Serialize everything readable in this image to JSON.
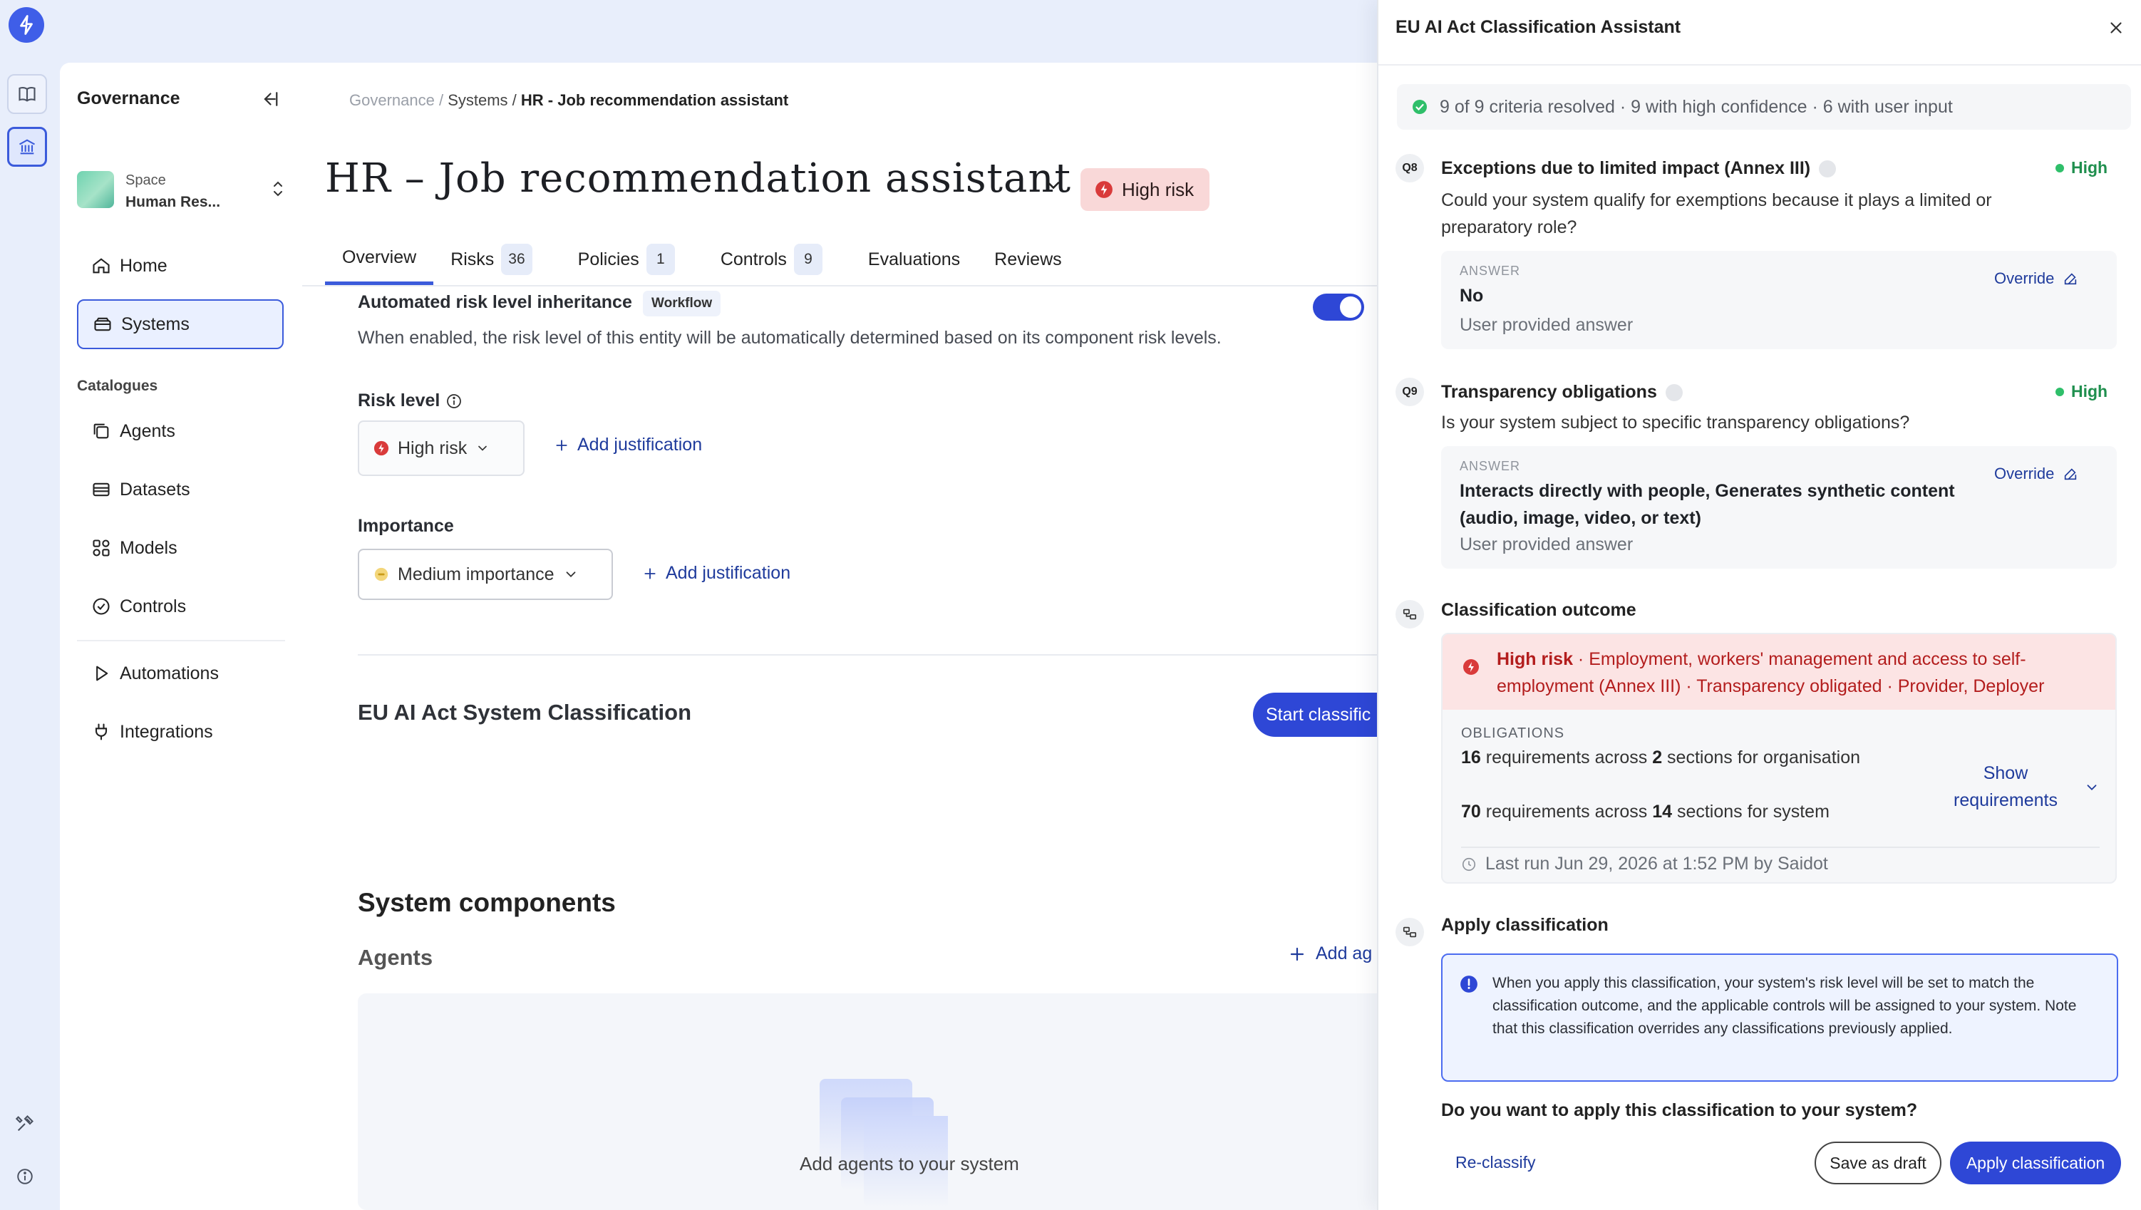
{
  "rail": {
    "logo_icon": "bolt-icon",
    "items": [
      "book-icon",
      "bank-icon"
    ],
    "bottom": [
      "tools-icon",
      "info-icon"
    ]
  },
  "nav": {
    "title": "Governance",
    "space": {
      "label": "Space",
      "name": "Human Res..."
    },
    "items": [
      {
        "label": "Home",
        "icon": "home-icon"
      },
      {
        "label": "Systems",
        "icon": "systems-icon"
      }
    ],
    "catalogues_label": "Catalogues",
    "catalogues": [
      {
        "label": "Agents",
        "icon": "agents-icon"
      },
      {
        "label": "Datasets",
        "icon": "datasets-icon"
      },
      {
        "label": "Models",
        "icon": "models-icon"
      },
      {
        "label": "Controls",
        "icon": "controls-icon"
      }
    ],
    "extras": [
      {
        "label": "Automations",
        "icon": "play-icon"
      },
      {
        "label": "Integrations",
        "icon": "plug-icon"
      }
    ]
  },
  "breadcrumb": {
    "root": "Governance",
    "sep": " / ",
    "parent": "Systems",
    "current": "HR - Job recommendation assistant"
  },
  "page": {
    "title": "HR – Job recommendation assistant",
    "risk_badge": "High risk",
    "tabs": [
      {
        "label": "Overview",
        "count": ""
      },
      {
        "label": "Risks",
        "count": "36"
      },
      {
        "label": "Policies",
        "count": "1"
      },
      {
        "label": "Controls",
        "count": "9"
      },
      {
        "label": "Evaluations",
        "count": ""
      },
      {
        "label": "Reviews",
        "count": ""
      }
    ],
    "inheritance": {
      "title": "Automated risk level inheritance",
      "chip": "Workflow",
      "desc": "When enabled, the risk level of this entity will be automatically determined based on its component risk levels.",
      "enabled": true
    },
    "risk_level": {
      "label": "Risk level",
      "value": "High risk",
      "add": "Add justification"
    },
    "importance": {
      "label": "Importance",
      "value": "Medium importance",
      "add": "Add justification"
    },
    "eu_section": {
      "title": "EU AI Act System Classification",
      "button": "Start classific"
    },
    "components": {
      "title": "System components",
      "agents": "Agents",
      "add_agent": "Add ag",
      "empty": "Add agents to your system"
    }
  },
  "drawer": {
    "title": "EU AI Act Classification Assistant",
    "summary": "9 of 9 criteria resolved · 9 with high confidence · 6 with user input",
    "questions": [
      {
        "id": "Q8",
        "title": "Exceptions due to limited impact (Annex III)",
        "confidence": "High",
        "text": "Could your system qualify for exemptions because it plays a limited or preparatory role?",
        "answer_label": "ANSWER",
        "answer": "No",
        "source": "User provided answer",
        "override": "Override"
      },
      {
        "id": "Q9",
        "title": "Transparency obligations",
        "confidence": "High",
        "text": "Is your system subject to specific transparency obligations?",
        "answer_label": "ANSWER",
        "answer": "Interacts directly with people, Generates synthetic content (audio, image, video, or text)",
        "source": "User provided answer",
        "override": "Override"
      }
    ],
    "outcome": {
      "title": "Classification outcome",
      "risk": "High risk",
      "detail": " · Employment, workers' management and access to self-employment (Annex III) · Transparency obligated · Provider, Deployer",
      "obligations_label": "OBLIGATIONS",
      "org": {
        "req": "16",
        "mid": " requirements across ",
        "sec": "2",
        "tail": " sections for organisation"
      },
      "sys": {
        "req": "70",
        "mid": " requirements across ",
        "sec": "14",
        "tail": " sections for system"
      },
      "show": "Show requirements",
      "last_run": "Last run Jun 29, 2026 at 1:52 PM by Saidot"
    },
    "apply": {
      "title": "Apply classification",
      "info": "When you apply this classification, your system's risk level will be set to match the classification outcome, and the applicable controls will be assigned to your system. Note that this classification overrides any classifications previously applied.",
      "question": "Do you want to apply this classification to your system?",
      "reclassify": "Re-classify",
      "draft": "Save as draft",
      "apply": "Apply classification"
    }
  },
  "colors": {
    "accent": "#2e47d6",
    "danger": "#d93b3b",
    "success": "#2fbf6a"
  }
}
